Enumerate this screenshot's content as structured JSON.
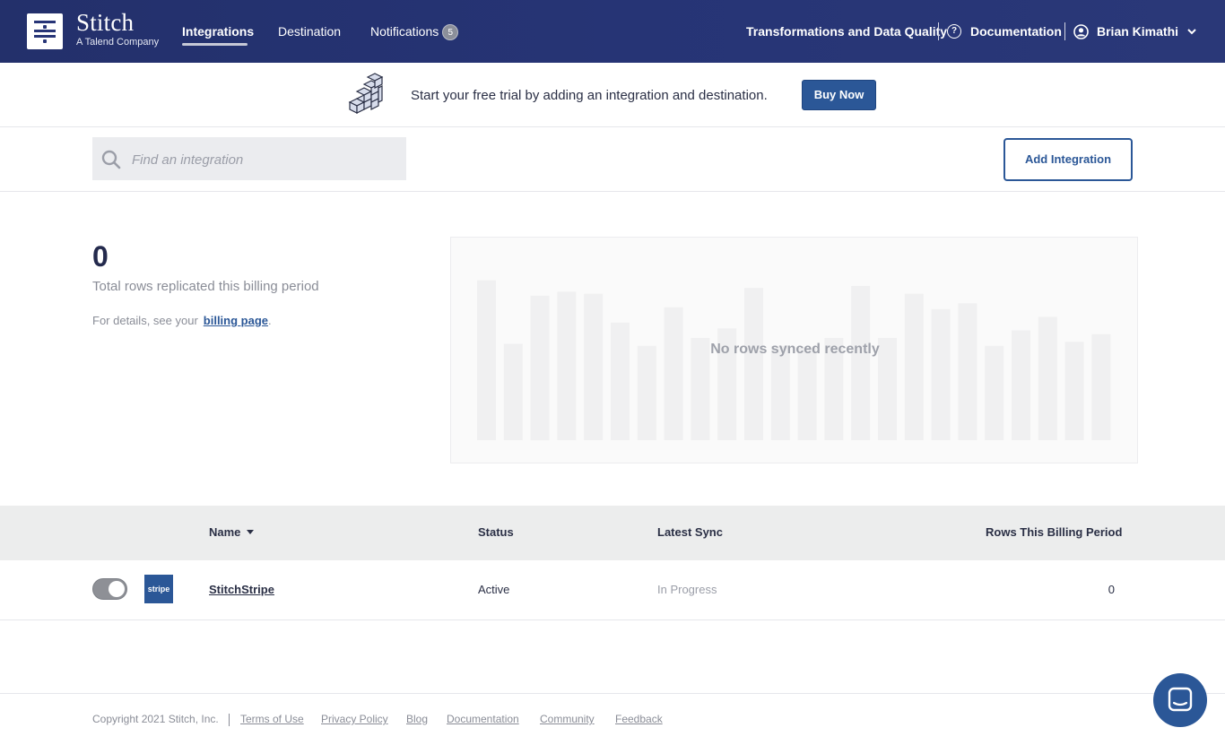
{
  "header": {
    "brand": "Stitch",
    "brand_sub": "A Talend Company",
    "nav": {
      "integrations": "Integrations",
      "destination": "Destination",
      "notifications": "Notifications",
      "notifications_count": "5"
    },
    "right": {
      "transformations": "Transformations and Data Quality",
      "documentation": "Documentation",
      "user": "Brian Kimathi"
    }
  },
  "banner": {
    "text": "Start your free trial by adding an integration and destination.",
    "buy_label": "Buy Now"
  },
  "search": {
    "placeholder": "Find an integration",
    "add_label": "Add Integration"
  },
  "stats": {
    "total_rows": "0",
    "total_label": "Total rows replicated this billing period",
    "details_prefix": "For details, see your",
    "billing_link": "billing page",
    "details_suffix": "."
  },
  "chart_data": {
    "type": "bar",
    "title": "",
    "empty_message": "No rows synced recently",
    "placeholder_bar_heights": [
      0.83,
      0.5,
      0.75,
      0.77,
      0.76,
      0.61,
      0.49,
      0.69,
      0.53,
      0.58,
      0.79,
      0.49,
      0.48,
      0.53,
      0.8,
      0.53,
      0.76,
      0.68,
      0.71,
      0.49,
      0.57,
      0.64,
      0.51,
      0.55
    ]
  },
  "table": {
    "columns": {
      "name": "Name",
      "status": "Status",
      "latest_sync": "Latest Sync",
      "rows": "Rows This Billing Period"
    },
    "rows": [
      {
        "logo_text": "stripe",
        "name": "StitchStripe",
        "status": "Active",
        "latest_sync": "In Progress",
        "rows": "0",
        "enabled": true
      }
    ]
  },
  "footer": {
    "copyright": "Copyright 2021 Stitch, Inc.",
    "links": {
      "terms": "Terms of Use",
      "privacy": "Privacy Policy",
      "blog": "Blog",
      "docs": "Documentation",
      "community": "Community",
      "feedback": "Feedback"
    }
  },
  "colors": {
    "header_bg": "#263475",
    "accent": "#2b5797",
    "table_header_bg": "#eceded"
  }
}
